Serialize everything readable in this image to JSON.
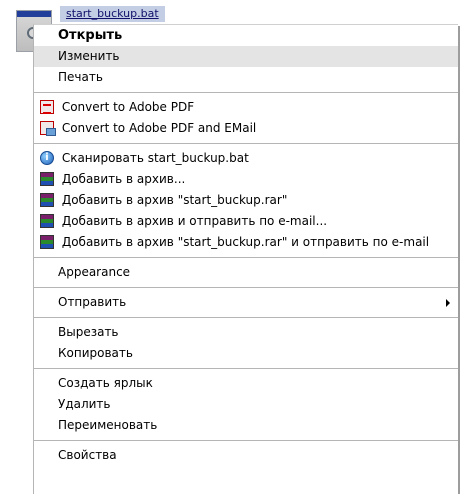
{
  "file": {
    "name": "start_buckup.bat"
  },
  "menu": {
    "open": "Открыть",
    "edit": "Изменить",
    "print": "Печать",
    "convert_pdf": "Convert to Adobe PDF",
    "convert_pdf_email": "Convert to Adobe PDF and EMail",
    "scan": "Сканировать start_buckup.bat",
    "add_archive": "Добавить в архив...",
    "add_archive_rar": "Добавить в архив \"start_buckup.rar\"",
    "add_archive_email": "Добавить в архив и отправить по e-mail...",
    "add_archive_rar_email": "Добавить в архив \"start_buckup.rar\" и отправить по e-mail",
    "appearance": "Appearance",
    "send_to": "Отправить",
    "cut": "Вырезать",
    "copy": "Копировать",
    "create_shortcut": "Создать ярлык",
    "delete": "Удалить",
    "rename": "Переименовать",
    "properties": "Свойства"
  },
  "icons": {
    "pdf": "adobe-pdf-icon",
    "pdf_email": "adobe-pdf-email-icon",
    "scan": "antivirus-icon",
    "archive": "winrar-icon"
  },
  "colors": {
    "highlight": "#e4e4e4",
    "file_label_bg": "#c3cde3"
  }
}
